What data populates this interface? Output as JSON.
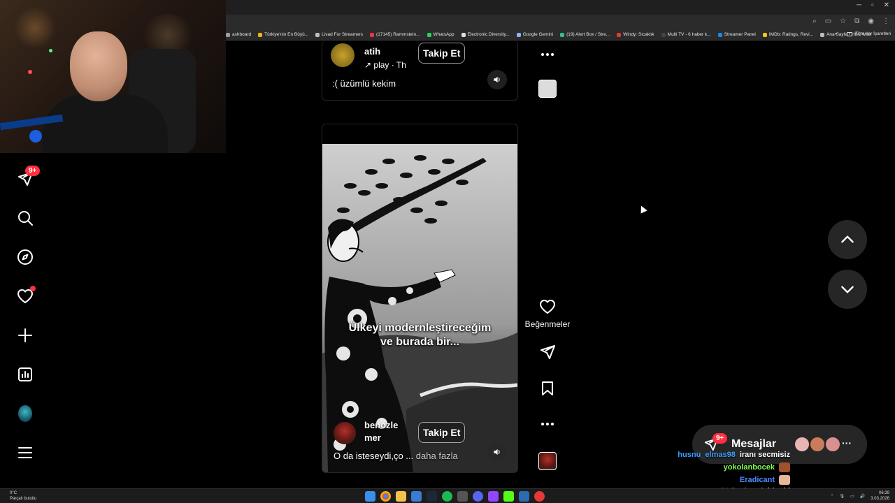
{
  "browser": {
    "bookmarks": [
      {
        "label": "ashboard",
        "color": "#9e9e9e"
      },
      {
        "label": "Türkiye'nin En Büyü...",
        "color": "#f2b705"
      },
      {
        "label": "Livad For Streamers",
        "color": "#bdbdbd"
      },
      {
        "label": "(17145) Rammstein...",
        "color": "#ff3040"
      },
      {
        "label": "WhatsApp",
        "color": "#25d366"
      },
      {
        "label": "Electronic Diversity...",
        "color": "#e0e0e0"
      },
      {
        "label": "Google Gemini",
        "color": "#8ab4f8"
      },
      {
        "label": "(19) Alert Box / Stre...",
        "color": "#31c48d"
      },
      {
        "label": "Windy: Sıcaklık",
        "color": "#e53935"
      },
      {
        "label": "Multi TV - 6 haber k...",
        "color": "#444444"
      },
      {
        "label": "Streamer Panel",
        "color": "#1e88e5"
      },
      {
        "label": "IMDb: Ratings, Revi...",
        "color": "#f5c518"
      },
      {
        "label": "Ana Sayfa • HBO Max",
        "color": "#bdbdbd"
      }
    ],
    "bookmarks_more": "»",
    "all_bookmarks": "Tüm Yer İşaretleri"
  },
  "sidebar": {
    "notifications_badge": "9+"
  },
  "reel_top": {
    "username_fragment": "atih",
    "song": "play · Th",
    "follow_label": "Takip Et",
    "caption": ":( üzümlü kekim"
  },
  "reel_main": {
    "overlay_line1": "Ülkeyi modernleştireceğim",
    "overlay_line2": "ve burada bir...",
    "username_line1": "benozle",
    "username_line2": "mer",
    "follow_label": "Takip Et",
    "caption": "O da isteseydi,ço ...",
    "caption_more": "daha fazla"
  },
  "actions": {
    "likes_label": "Beğenmeler"
  },
  "messages": {
    "label": "Mesajlar",
    "badge": "9+"
  },
  "chat": [
    {
      "user": "husnu_elmas98",
      "text": "iranı secmisiz",
      "color": "#3d9cff",
      "emote": ""
    },
    {
      "user": "yokolanbocek",
      "text": "",
      "color": "#7cff4d",
      "emote": "#a0522d"
    },
    {
      "user": "Eradicant",
      "text": "",
      "color": "#4d8cff",
      "emote": "#e8b49a"
    },
    {
      "user": "MrBorisowl",
      "text": "hb abi",
      "color": "#c08cff",
      "emote": ""
    }
  ],
  "taskbar": {
    "weather_temp": "0°C",
    "weather_desc": "Parçalı bulutlu",
    "time": "06:39",
    "date": "3.03.2026"
  },
  "colors": {
    "accent_red": "#ff3040",
    "surface": "#262626"
  }
}
